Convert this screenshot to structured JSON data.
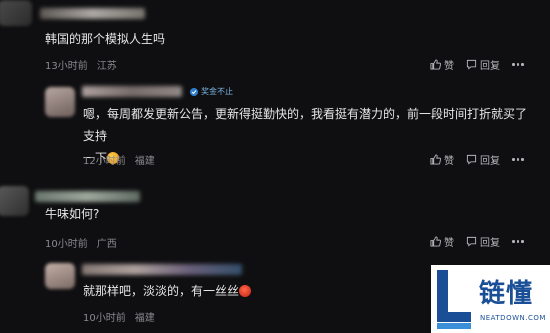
{
  "comments": [
    {
      "text": "韩国的那个模拟人生吗",
      "time": "13小时前",
      "location": "江苏"
    },
    {
      "badge": "奖金不止",
      "text_line1": "嗯，每周都发更新公告，更新得挺勤快的，我看挺有潜力的，前一段时间打折就买了支持",
      "text_line2": "一下",
      "time": "12小时前",
      "location": "福建"
    },
    {
      "text": "牛味如何?",
      "time": "10小时前",
      "location": "广西"
    },
    {
      "text": "就那样吧，淡淡的，有一丝丝",
      "time": "10小时前",
      "location": "福建"
    }
  ],
  "actions": {
    "like": "赞",
    "reply": "回复"
  },
  "watermark": {
    "cn": "链懂",
    "en": "NEATDOWN.COM"
  },
  "icons": [
    "thumb-up-icon",
    "chat-bubble-icon",
    "more-icon",
    "medal-icon",
    "emoji-icon"
  ]
}
